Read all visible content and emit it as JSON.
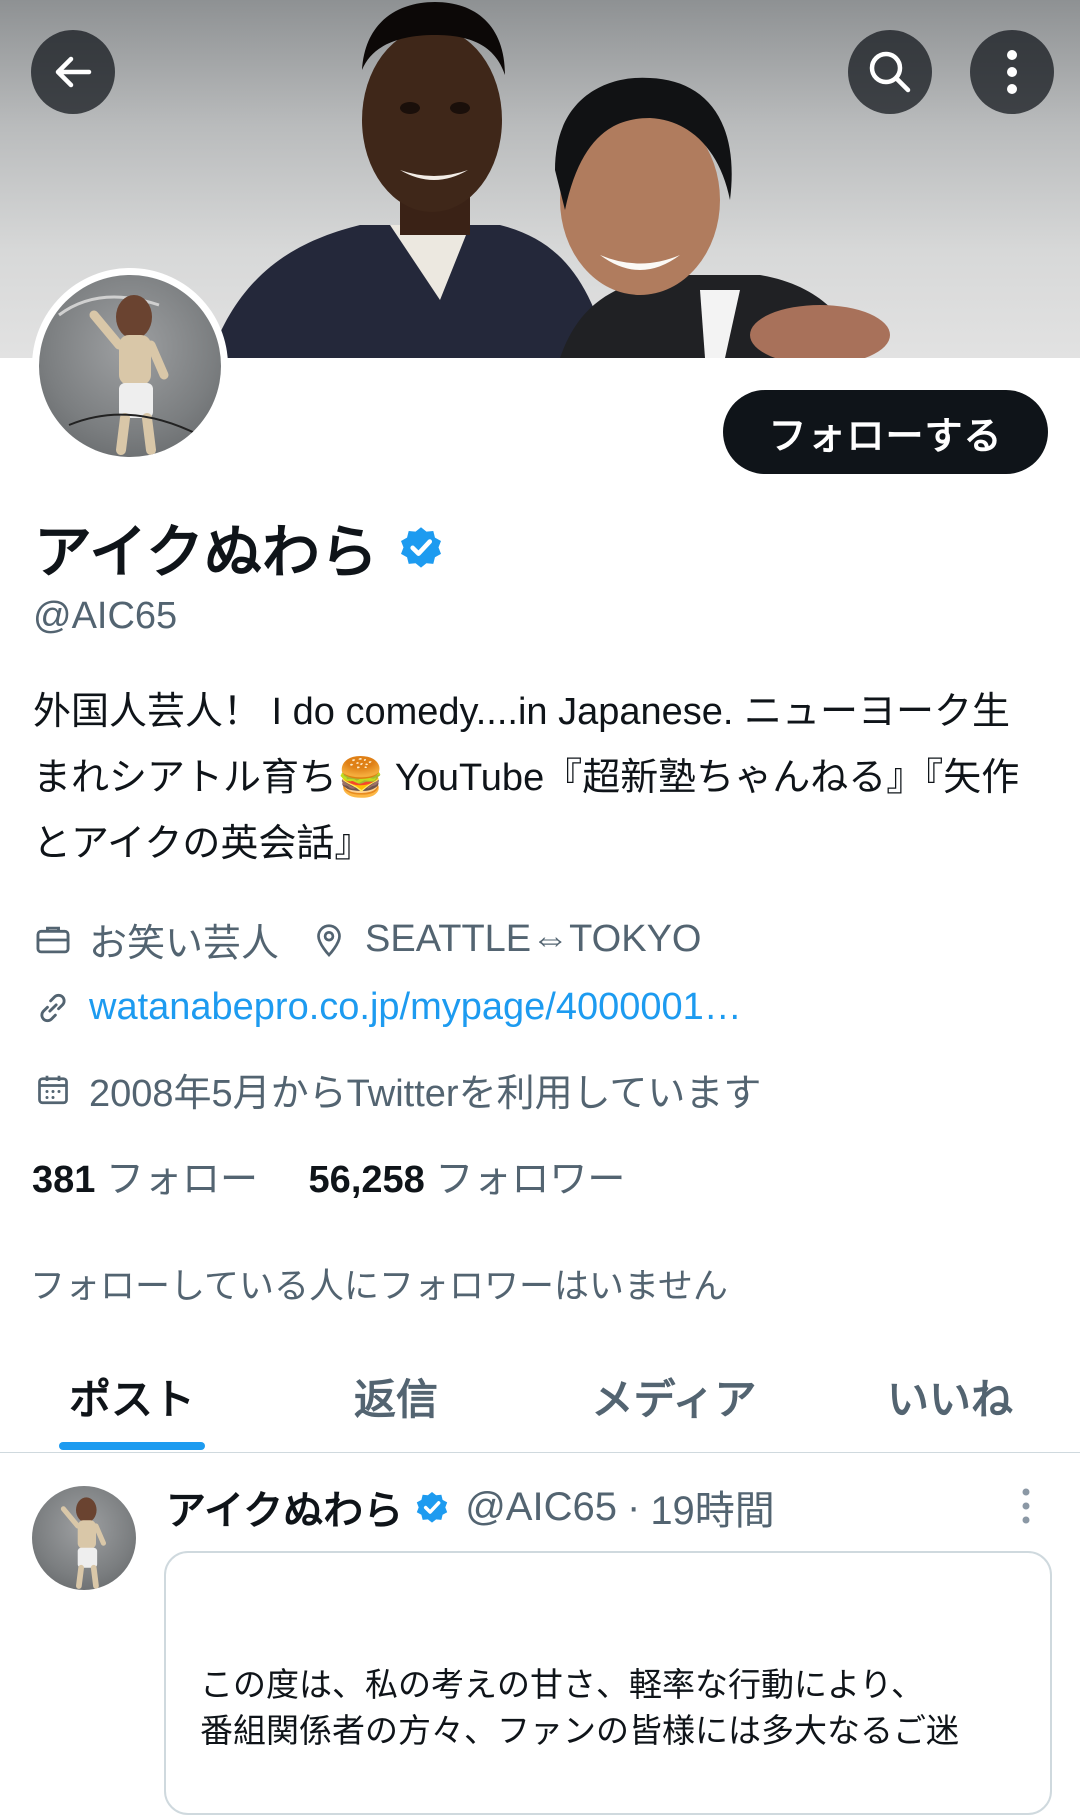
{
  "header": {
    "back_icon": "arrow-left-icon",
    "search_icon": "search-icon",
    "more_icon": "more-vertical-icon"
  },
  "profile": {
    "follow_button": "フォローする",
    "name": "アイクぬわら",
    "verified_icon": "verified-badge-icon",
    "handle": "@AIC65",
    "bio": "外国人芸人！ I do comedy....in Japanese. ニューヨーク生まれシアトル育ち🍔 YouTube『超新塾ちゃんねる』『矢作とアイクの英会話』",
    "job": "お笑い芸人",
    "location": "SEATTLE⇔TOKYO",
    "url": "watanabepro.co.jp/mypage/4000001…",
    "joined": "2008年5月からTwitterを利用しています",
    "following_count": "381",
    "following_label": "フォロー",
    "followers_count": "56,258",
    "followers_label": "フォロワー",
    "mutual_notice": "フォローしている人にフォロワーはいません"
  },
  "tabs": [
    {
      "label": "ポスト",
      "active": true
    },
    {
      "label": "返信",
      "active": false
    },
    {
      "label": "メディア",
      "active": false
    },
    {
      "label": "いいね",
      "active": false
    }
  ],
  "post": {
    "name": "アイクぬわら",
    "handle": "@AIC65",
    "separator": "·",
    "time": "19時間",
    "quote_line1": "この度は、私の考えの甘さ、軽率な行動により、",
    "quote_line2": "番組関係者の方々、ファンの皆様には多大なるご迷"
  },
  "colors": {
    "accent": "#1d9bf0",
    "text_primary": "#0f1419",
    "text_secondary": "#536471",
    "follow_button_bg": "#0f1419"
  }
}
